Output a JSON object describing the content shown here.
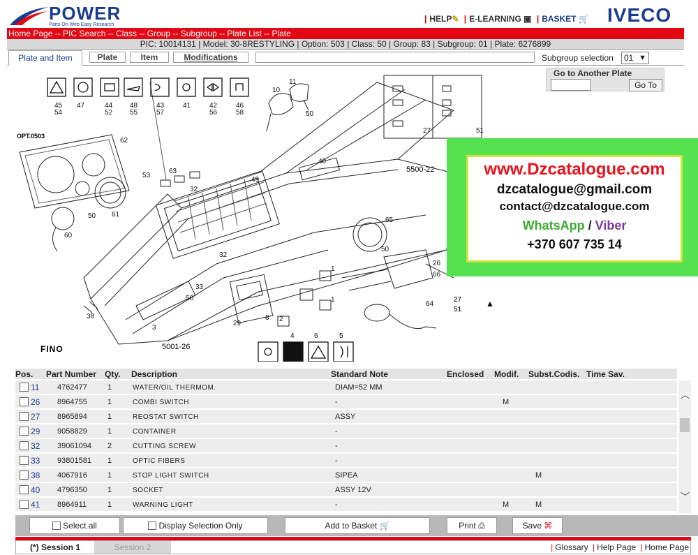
{
  "header": {
    "logo_word": "POWER",
    "logo_tagline": "Parts On Web Easy Research",
    "help": "HELP",
    "elearning": "E-LEARNING",
    "basket": "BASKET",
    "brand": "IVECO"
  },
  "breadcrumb": "Home Page -- PIC Search -- Class -- Group -- Subgroup -- Plate List -- Plate",
  "info": "PIC: 10014131 | Model: 30-8RESTYLING | Option: 503 | Class: 50 | Group: 83 | Subgroup: 01 | Plate: 6276899",
  "tabs": {
    "plate_item": "Plate and Item",
    "plate": "Plate",
    "item": "Item",
    "modifications": "Modifications"
  },
  "subgroup": {
    "label": "Subgroup selection",
    "value": "01"
  },
  "goto": {
    "title": "Go to Another Plate",
    "button": "Go To"
  },
  "drawing": {
    "opt": "OPT.0503",
    "fino": "FINO",
    "code1": "5500-22",
    "code2": "5001-26",
    "labels": [
      "45",
      "54",
      "47",
      "44",
      "52",
      "48",
      "55",
      "43",
      "57",
      "41",
      "42",
      "56",
      "46",
      "58",
      "10",
      "11",
      "50",
      "62",
      "53",
      "63",
      "49",
      "32",
      "61",
      "50",
      "60",
      "40",
      "65",
      "50",
      "26",
      "66",
      "27",
      "51",
      "64",
      "33",
      "50",
      "38",
      "3",
      "29",
      "8",
      "2",
      "4",
      "6",
      "5",
      "1",
      "1",
      "32",
      "27",
      "51",
      "27",
      "51"
    ]
  },
  "promo": {
    "site": "www.Dzcatalogue.com",
    "email1": "dzcatalogue@gmail.com",
    "email2": "contact@dzcatalogue.com",
    "whatsapp": "WhatsApp",
    "slash": " / ",
    "viber": "Viber",
    "phone": "+370 607 735 14"
  },
  "table": {
    "headers": {
      "pos": "Pos.",
      "part": "Part Number",
      "qty": "Qty.",
      "desc": "Description",
      "note": "Standard Note",
      "enclosed": "Enclosed",
      "modif": "Modif.",
      "subst": "Subst.Codis.",
      "time": "Time Sav."
    },
    "rows": [
      {
        "pos": "11",
        "part": "4762477",
        "qty": "1",
        "desc": "WATER/OIL THERMOM.",
        "note": "DIAM=52 MM",
        "modif": "",
        "subst": ""
      },
      {
        "pos": "26",
        "part": "8964755",
        "qty": "1",
        "desc": "COMBI SWITCH",
        "note": "-",
        "modif": "M",
        "subst": ""
      },
      {
        "pos": "27",
        "part": "8965894",
        "qty": "1",
        "desc": "REOSTAT SWITCH",
        "note": "ASSY",
        "modif": "",
        "subst": ""
      },
      {
        "pos": "29",
        "part": "9058829",
        "qty": "1",
        "desc": "CONTAINER",
        "note": "-",
        "modif": "",
        "subst": ""
      },
      {
        "pos": "32",
        "part": "39061094",
        "qty": "2",
        "desc": "CUTTING SCREW",
        "note": "-",
        "modif": "",
        "subst": ""
      },
      {
        "pos": "33",
        "part": "93801581",
        "qty": "1",
        "desc": "OPTIC FIBERS",
        "note": "-",
        "modif": "",
        "subst": ""
      },
      {
        "pos": "38",
        "part": "4067916",
        "qty": "1",
        "desc": "STOP LIGHT SWITCH",
        "note": "SIPEA",
        "modif": "",
        "subst": "M"
      },
      {
        "pos": "40",
        "part": "4796350",
        "qty": "1",
        "desc": "SOCKET",
        "note": "ASSY 12V",
        "modif": "",
        "subst": ""
      },
      {
        "pos": "41",
        "part": "8964911",
        "qty": "1",
        "desc": "WARNING LIGHT",
        "note": "-",
        "modif": "M",
        "subst": "M"
      }
    ]
  },
  "toolbar": {
    "select_all": "Select all",
    "display_selection": "Display Selection Only",
    "add_basket": "Add to Basket",
    "print": "Print",
    "save": "Save"
  },
  "session": {
    "s1": "(*) Session 1",
    "s2": "Session 2",
    "glossary": "Glossary",
    "help_page": "Help Page",
    "home_page": "Home Page"
  },
  "colors": {
    "brand_blue": "#1a3c8c",
    "red": "#e30613",
    "promo_green": "#55e24f"
  }
}
